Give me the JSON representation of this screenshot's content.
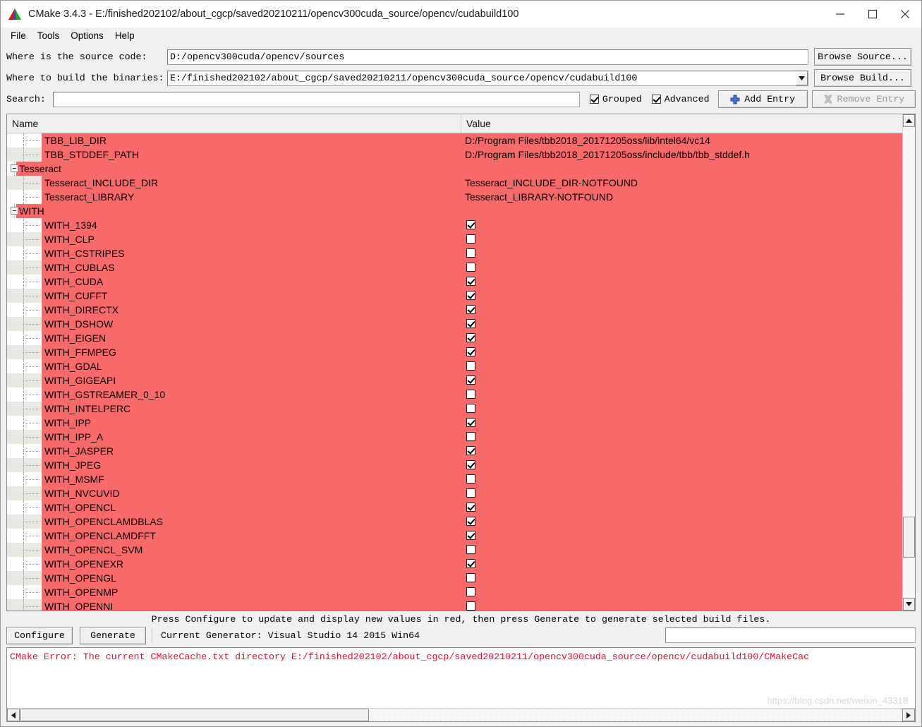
{
  "window": {
    "title": "CMake 3.4.3 - E:/finished202102/about_cgcp/saved20210211/opencv300cuda_source/opencv/cudabuild100",
    "minimize_label": "minimize-icon",
    "maximize_label": "maximize-icon",
    "close_label": "close-icon"
  },
  "menu": {
    "items": [
      {
        "label": "File"
      },
      {
        "label": "Tools"
      },
      {
        "label": "Options"
      },
      {
        "label": "Help"
      }
    ]
  },
  "form": {
    "source_label": "Where is the source code:",
    "source_value": "D:/opencv300cuda/opencv/sources",
    "browse_source_label": "Browse Source...",
    "build_label": "Where to build the binaries:",
    "build_value": "E:/finished202102/about_cgcp/saved20210211/opencv300cuda_source/opencv/cudabuild100",
    "browse_build_label": "Browse Build...",
    "search_label": "Search:",
    "search_value": "",
    "search_placeholder": "",
    "grouped_label": "Grouped",
    "grouped_checked": true,
    "advanced_label": "Advanced",
    "advanced_checked": true,
    "add_entry_label": "Add Entry",
    "remove_entry_label": "Remove Entry",
    "remove_entry_disabled": true
  },
  "table": {
    "columns": [
      "Name",
      "Value"
    ],
    "rows": [
      {
        "type": "entry",
        "name": "TBB_LIB_DIR",
        "value": "D:/Program Files/tbb2018_20171205oss/lib/intel64/vc14",
        "kind": "text"
      },
      {
        "type": "entry",
        "name": "TBB_STDDEF_PATH",
        "value": "D:/Program Files/tbb2018_20171205oss/include/tbb/tbb_stddef.h",
        "kind": "text"
      },
      {
        "type": "group",
        "name": "Tesseract",
        "value": "",
        "kind": "none"
      },
      {
        "type": "entry",
        "name": "Tesseract_INCLUDE_DIR",
        "value": "Tesseract_INCLUDE_DIR-NOTFOUND",
        "kind": "text"
      },
      {
        "type": "entry",
        "name": "Tesseract_LIBRARY",
        "value": "Tesseract_LIBRARY-NOTFOUND",
        "kind": "text"
      },
      {
        "type": "group",
        "name": "WITH",
        "value": "",
        "kind": "none"
      },
      {
        "type": "entry",
        "name": "WITH_1394",
        "value": true,
        "kind": "bool"
      },
      {
        "type": "entry",
        "name": "WITH_CLP",
        "value": false,
        "kind": "bool"
      },
      {
        "type": "entry",
        "name": "WITH_CSTRIPES",
        "value": false,
        "kind": "bool"
      },
      {
        "type": "entry",
        "name": "WITH_CUBLAS",
        "value": false,
        "kind": "bool"
      },
      {
        "type": "entry",
        "name": "WITH_CUDA",
        "value": true,
        "kind": "bool"
      },
      {
        "type": "entry",
        "name": "WITH_CUFFT",
        "value": true,
        "kind": "bool"
      },
      {
        "type": "entry",
        "name": "WITH_DIRECTX",
        "value": true,
        "kind": "bool"
      },
      {
        "type": "entry",
        "name": "WITH_DSHOW",
        "value": true,
        "kind": "bool"
      },
      {
        "type": "entry",
        "name": "WITH_EIGEN",
        "value": true,
        "kind": "bool"
      },
      {
        "type": "entry",
        "name": "WITH_FFMPEG",
        "value": true,
        "kind": "bool"
      },
      {
        "type": "entry",
        "name": "WITH_GDAL",
        "value": false,
        "kind": "bool"
      },
      {
        "type": "entry",
        "name": "WITH_GIGEAPI",
        "value": true,
        "kind": "bool"
      },
      {
        "type": "entry",
        "name": "WITH_GSTREAMER_0_10",
        "value": false,
        "kind": "bool"
      },
      {
        "type": "entry",
        "name": "WITH_INTELPERC",
        "value": false,
        "kind": "bool"
      },
      {
        "type": "entry",
        "name": "WITH_IPP",
        "value": true,
        "kind": "bool"
      },
      {
        "type": "entry",
        "name": "WITH_IPP_A",
        "value": false,
        "kind": "bool"
      },
      {
        "type": "entry",
        "name": "WITH_JASPER",
        "value": true,
        "kind": "bool"
      },
      {
        "type": "entry",
        "name": "WITH_JPEG",
        "value": true,
        "kind": "bool"
      },
      {
        "type": "entry",
        "name": "WITH_MSMF",
        "value": false,
        "kind": "bool"
      },
      {
        "type": "entry",
        "name": "WITH_NVCUVID",
        "value": false,
        "kind": "bool"
      },
      {
        "type": "entry",
        "name": "WITH_OPENCL",
        "value": true,
        "kind": "bool"
      },
      {
        "type": "entry",
        "name": "WITH_OPENCLAMDBLAS",
        "value": true,
        "kind": "bool"
      },
      {
        "type": "entry",
        "name": "WITH_OPENCLAMDFFT",
        "value": true,
        "kind": "bool"
      },
      {
        "type": "entry",
        "name": "WITH_OPENCL_SVM",
        "value": false,
        "kind": "bool"
      },
      {
        "type": "entry",
        "name": "WITH_OPENEXR",
        "value": true,
        "kind": "bool"
      },
      {
        "type": "entry",
        "name": "WITH_OPENGL",
        "value": false,
        "kind": "bool"
      },
      {
        "type": "entry",
        "name": "WITH_OPENMP",
        "value": false,
        "kind": "bool"
      },
      {
        "type": "entry",
        "name": "WITH_OPENNI",
        "value": false,
        "kind": "bool"
      }
    ]
  },
  "bottom": {
    "hint": "Press Configure to update and display new values in red, then press Generate to generate selected build files.",
    "configure_label": "Configure",
    "generate_label": "Generate",
    "generator_label": "Current Generator: Visual Studio 14 2015 Win64"
  },
  "output": {
    "error_text": "CMake Error: The current CMakeCache.txt directory E:/finished202102/about_cgcp/saved20210211/opencv300cuda_source/opencv/cudabuild100/CMakeCac",
    "watermark": "https://blog.csdn.net/weixin_43318"
  },
  "colors": {
    "new_value_red": "#fb6a6a",
    "error_red": "#e8112d",
    "window_bg": "#f0f0f0"
  }
}
